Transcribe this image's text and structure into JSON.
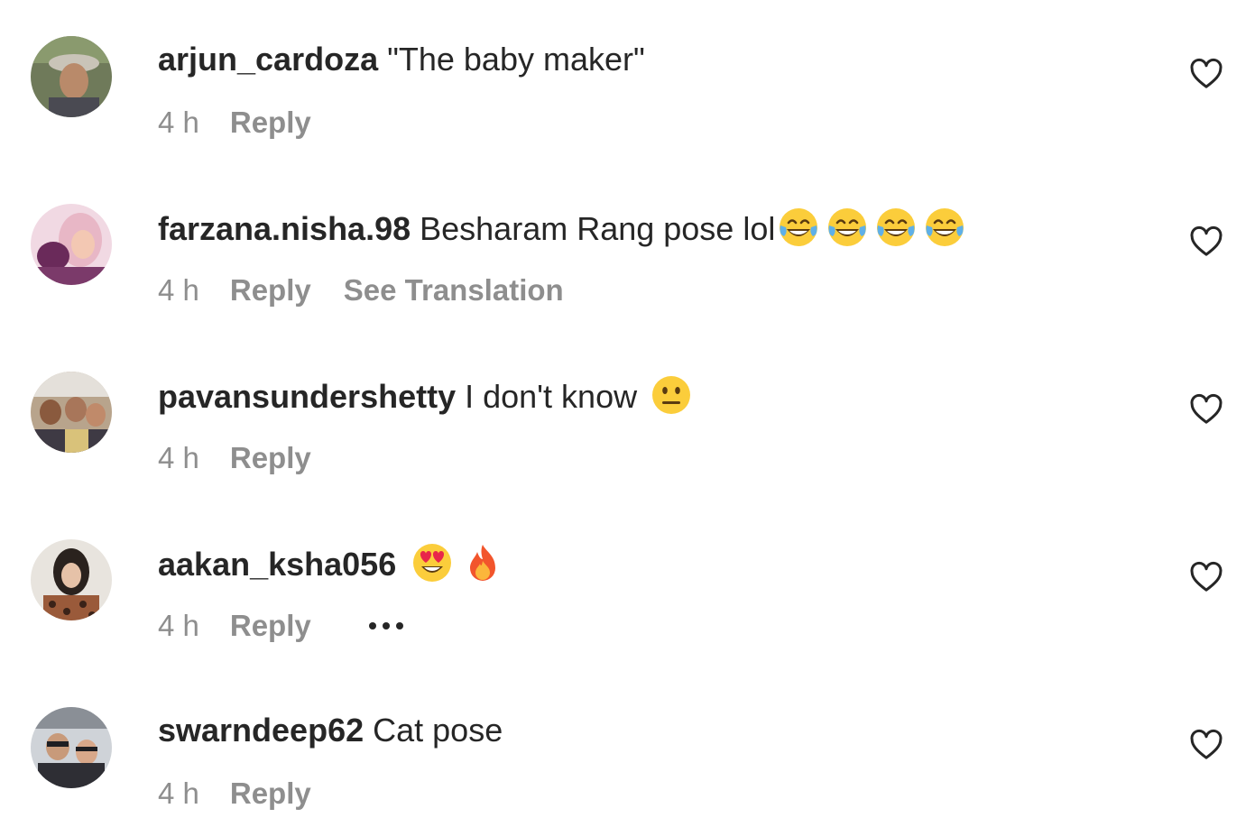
{
  "comments": [
    {
      "username": "arjun_cardoza",
      "text": " \"The baby maker\"",
      "emojis": [],
      "time": "4 h",
      "reply_label": "Reply",
      "translation_label": "",
      "avatar_icon": "user-avatar-photo"
    },
    {
      "username": "farzana.nisha.98",
      "text": " Besharam Rang pose lol",
      "emojis": [
        "tears-of-joy",
        "tears-of-joy",
        "tears-of-joy",
        "tears-of-joy"
      ],
      "time": "4 h",
      "reply_label": "Reply",
      "translation_label": "See Translation",
      "avatar_icon": "user-avatar-photo"
    },
    {
      "username": "pavansundershetty",
      "text": " I don't know ",
      "emojis": [
        "neutral-face"
      ],
      "time": "4 h",
      "reply_label": "Reply",
      "translation_label": "",
      "avatar_icon": "user-avatar-photo"
    },
    {
      "username": "aakan_ksha056",
      "text": " ",
      "emojis": [
        "heart-eyes",
        "fire"
      ],
      "time": "4 h",
      "reply_label": "Reply",
      "translation_label": "",
      "more_icon": "ellipsis-icon",
      "avatar_icon": "user-avatar-photo"
    },
    {
      "username": "swarndeep62",
      "text": " Cat pose",
      "emojis": [],
      "time": "4 h",
      "reply_label": "Reply",
      "translation_label": "",
      "avatar_icon": "user-avatar-photo"
    }
  ],
  "icons": {
    "like": "heart-outline-icon"
  },
  "colors": {
    "text": "#262626",
    "secondary": "#8e8e8e",
    "background": "#ffffff"
  }
}
